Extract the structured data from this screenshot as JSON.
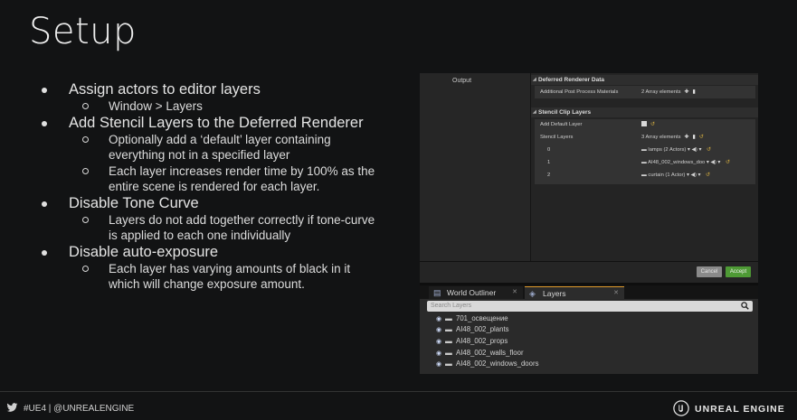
{
  "slide": {
    "title": "Setup",
    "bullets": [
      {
        "text": "Assign actors to editor layers",
        "sub": [
          "Window > Layers"
        ]
      },
      {
        "text": "Add Stencil Layers to the Deferred Renderer",
        "sub": [
          "Optionally add a ‘default’ layer containing everything not in a specified layer",
          "Each layer increases render time by 100% as the entire scene is rendered for each layer."
        ]
      },
      {
        "text": "Disable Tone Curve",
        "sub": [
          "Layers do not add together correctly if tone-curve is applied to each one individually"
        ]
      },
      {
        "text": "Disable auto-exposure",
        "sub": [
          "Each layer has varying amounts of black in it which will change exposure amount."
        ]
      }
    ]
  },
  "editor": {
    "left_label": "Output",
    "deferred": {
      "header": "Deferred Renderer Data",
      "row_label": "Additional Post Process Materials",
      "row_value": "2 Array elements"
    },
    "stencil": {
      "header": "Stencil Clip Layers",
      "add_default_label": "Add Default Layer",
      "layers_label": "Stencil Layers",
      "layers_value": "3 Array elements",
      "items": [
        {
          "index": "0",
          "value": "lamps (2 Actors)"
        },
        {
          "index": "1",
          "value": "AI48_002_windows_doo"
        },
        {
          "index": "2",
          "value": "curtain (1 Actor)"
        }
      ]
    },
    "buttons": {
      "cancel": "Cancel",
      "accept": "Accept"
    },
    "tabs": {
      "outliner": "World Outliner",
      "layers": "Layers"
    },
    "search_placeholder": "Search Layers",
    "layers": [
      "701_освещение",
      "AI48_002_plants",
      "AI48_002_props",
      "AI48_002_walls_floor",
      "AI48_002_windows_doors"
    ]
  },
  "footer": {
    "social": "#UE4 | @UNREALENGINE",
    "brand": "UNREAL ENGINE"
  },
  "colors": {
    "background": "#121314",
    "accept_button": "#4e9a35",
    "active_tab_accent": "#e09a2a"
  },
  "icons": [
    "twitter-icon",
    "unreal-logo-icon",
    "search-icon",
    "eye-icon",
    "layers-icon",
    "world-outliner-icon"
  ]
}
